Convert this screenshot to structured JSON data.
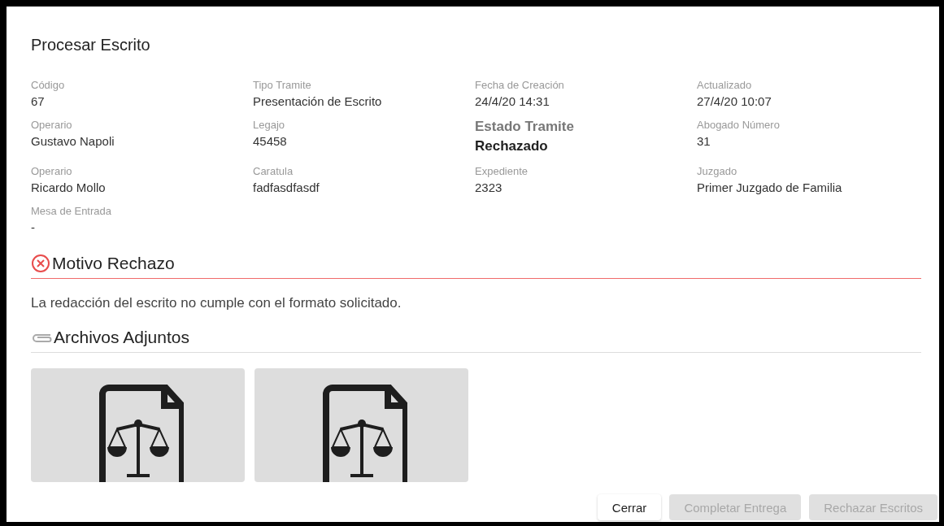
{
  "dialog": {
    "title": "Procesar Escrito"
  },
  "fields": [
    {
      "label": "Código",
      "value": "67",
      "kind": "plain"
    },
    {
      "label": "Tipo Tramite",
      "value": "Presentación de Escrito",
      "kind": "plain"
    },
    {
      "label": "Fecha de Creación",
      "value": "24/4/20 14:31",
      "kind": "plain"
    },
    {
      "label": "Actualizado",
      "value": "27/4/20 10:07",
      "kind": "plain"
    },
    {
      "label": "Operario",
      "value": "Gustavo Napoli",
      "kind": "plain"
    },
    {
      "label": "Legajo",
      "value": "45458",
      "kind": "plain"
    },
    {
      "label": "Estado Tramite",
      "value": "Rechazado",
      "kind": "status"
    },
    {
      "label": "Abogado Número",
      "value": "31",
      "kind": "plain"
    },
    {
      "label": "Operario",
      "value": "Ricardo Mollo",
      "kind": "plain"
    },
    {
      "label": "Caratula",
      "value": "fadfasdfasdf",
      "kind": "plain"
    },
    {
      "label": "Expediente",
      "value": "2323",
      "kind": "plain"
    },
    {
      "label": "Juzgado",
      "value": "Primer Juzgado de Familia",
      "kind": "plain"
    },
    {
      "label": "Mesa de Entrada",
      "value": "-",
      "kind": "plain"
    }
  ],
  "rejection": {
    "title": "Motivo Rechazo",
    "text": "La redacción del escrito no cumple con el formato solicitado."
  },
  "attachments": {
    "title": "Archivos Adjuntos",
    "files": [
      {
        "kind": "legal-document"
      },
      {
        "kind": "legal-document"
      }
    ]
  },
  "buttons": [
    {
      "label": "Cerrar",
      "disabled": false
    },
    {
      "label": "Completar Entrega",
      "disabled": true
    },
    {
      "label": "Rechazar Escritos",
      "disabled": true
    }
  ]
}
